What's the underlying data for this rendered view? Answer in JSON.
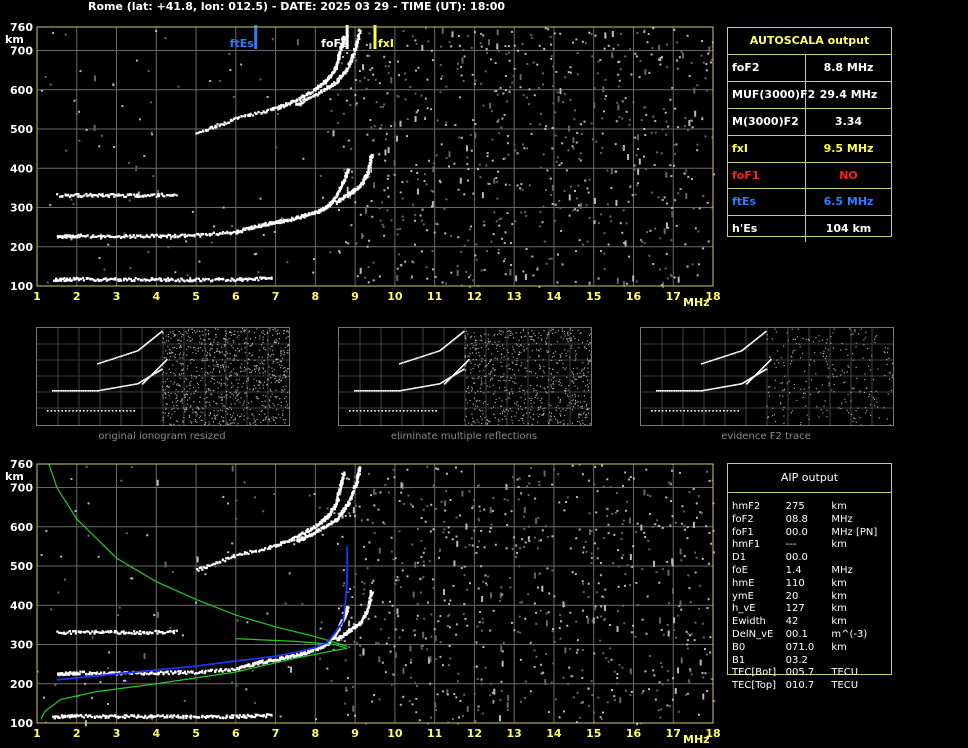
{
  "header": "Rome (lat: +41.8, lon: 012.5) - DATE: 2025 03 29 - TIME (UT): 18:00",
  "chart_data": {
    "type": "scatter",
    "xlabel": "MHz",
    "ylabel": "km",
    "xlim": [
      1,
      18
    ],
    "ylim": [
      100,
      760
    ],
    "xticks": [
      1,
      2,
      3,
      4,
      5,
      6,
      7,
      8,
      9,
      10,
      11,
      12,
      13,
      14,
      15,
      16,
      17,
      18
    ],
    "yticks": [
      100,
      200,
      300,
      400,
      500,
      600,
      700,
      760
    ],
    "grid": true,
    "markers": [
      {
        "label": "ftEs",
        "x": 6.5,
        "color": "#2f7cff"
      },
      {
        "label": "foF2",
        "x": 8.8,
        "color": "#ffffff"
      },
      {
        "label": "fxI",
        "x": 9.5,
        "color": "#ffff33"
      }
    ],
    "traces": [
      {
        "name": "Es",
        "points": [
          [
            1.4,
            118
          ],
          [
            2,
            120
          ],
          [
            3,
            119
          ],
          [
            4,
            119
          ],
          [
            5,
            118
          ],
          [
            6,
            119
          ],
          [
            6.9,
            122
          ]
        ]
      },
      {
        "name": "Es-2nd",
        "points": [
          [
            1.5,
            333
          ],
          [
            2.5,
            334
          ],
          [
            3.5,
            333
          ],
          [
            4.5,
            335
          ]
        ]
      },
      {
        "name": "F-ordinary",
        "points": [
          [
            1.5,
            228
          ],
          [
            2,
            230
          ],
          [
            3,
            229
          ],
          [
            4,
            230
          ],
          [
            5,
            232
          ],
          [
            6,
            240
          ],
          [
            6.5,
            255
          ],
          [
            7,
            265
          ],
          [
            7.5,
            275
          ],
          [
            8,
            290
          ],
          [
            8.3,
            305
          ],
          [
            8.5,
            330
          ],
          [
            8.7,
            370
          ],
          [
            8.8,
            400
          ]
        ]
      },
      {
        "name": "F-extraordinary",
        "points": [
          [
            8.5,
            315
          ],
          [
            8.8,
            335
          ],
          [
            9.1,
            355
          ],
          [
            9.3,
            390
          ],
          [
            9.4,
            440
          ]
        ]
      },
      {
        "name": "F-2hop-ordinary",
        "points": [
          [
            5,
            492
          ],
          [
            6,
            530
          ],
          [
            7,
            555
          ],
          [
            7.5,
            575
          ],
          [
            8,
            605
          ],
          [
            8.3,
            630
          ],
          [
            8.5,
            660
          ],
          [
            8.6,
            700
          ],
          [
            8.7,
            740
          ]
        ]
      },
      {
        "name": "F-2hop-extraordinary",
        "points": [
          [
            7.5,
            565
          ],
          [
            8,
            590
          ],
          [
            8.5,
            620
          ],
          [
            8.8,
            660
          ],
          [
            9,
            710
          ],
          [
            9.1,
            755
          ]
        ]
      }
    ],
    "profile_blue": [
      [
        1.5,
        210
      ],
      [
        2,
        215
      ],
      [
        3,
        225
      ],
      [
        4,
        235
      ],
      [
        5,
        245
      ],
      [
        6,
        258
      ],
      [
        7,
        270
      ],
      [
        7.5,
        280
      ],
      [
        8,
        292
      ],
      [
        8.3,
        305
      ],
      [
        8.5,
        330
      ],
      [
        8.7,
        360
      ],
      [
        8.75,
        400
      ],
      [
        8.8,
        460
      ],
      [
        8.8,
        550
      ]
    ],
    "profile_green_lower": [
      [
        1.1,
        110
      ],
      [
        1.2,
        130
      ],
      [
        1.6,
        160
      ],
      [
        2.5,
        180
      ],
      [
        4,
        200
      ],
      [
        6,
        230
      ],
      [
        7.5,
        265
      ],
      [
        8.5,
        285
      ],
      [
        8.8,
        290
      ],
      [
        8.5,
        300
      ],
      [
        7.5,
        308
      ],
      [
        6,
        315
      ]
    ],
    "profile_green_upper": [
      [
        1.3,
        760
      ],
      [
        1.5,
        700
      ],
      [
        2,
        620
      ],
      [
        3,
        520
      ],
      [
        4,
        460
      ],
      [
        5,
        415
      ],
      [
        6,
        375
      ],
      [
        7,
        345
      ],
      [
        8,
        320
      ],
      [
        8.5,
        305
      ],
      [
        8.8,
        295
      ]
    ]
  },
  "autoscala": {
    "title": "AUTOSCALA output",
    "rows": [
      {
        "key": "foF2",
        "value": "8.8 MHz",
        "color": "#ffffff"
      },
      {
        "key": "MUF(3000)F2",
        "value": "29.4 MHz",
        "color": "#ffffff"
      },
      {
        "key": "M(3000)F2",
        "value": "3.34",
        "color": "#ffffff"
      },
      {
        "key": "fxI",
        "value": "9.5 MHz",
        "color": "#ffff33"
      },
      {
        "key": "foF1",
        "value": "NO",
        "color": "#ff2222"
      },
      {
        "key": "ftEs",
        "value": "6.5 MHz",
        "color": "#2f7cff"
      },
      {
        "key": "h'Es",
        "value": "104    km",
        "color": "#ffffff"
      }
    ]
  },
  "thumbnails": [
    {
      "label": "original ionogram resized"
    },
    {
      "label": "eliminate multiple reflections"
    },
    {
      "label": "evidence F2 trace"
    }
  ],
  "aip": {
    "title": "AIP output",
    "rows": [
      {
        "key": "hmF2",
        "value": "275",
        "unit": "km"
      },
      {
        "key": "foF2",
        "value": "08.8",
        "unit": "MHz"
      },
      {
        "key": "foF1",
        "value": "00.0",
        "unit": "MHz    [PN]"
      },
      {
        "key": "hmF1",
        "value": "---",
        "unit": "km"
      },
      {
        "key": "D1",
        "value": "00.0",
        "unit": ""
      },
      {
        "key": "foE",
        "value": "1.4",
        "unit": "MHz"
      },
      {
        "key": "hmE",
        "value": "110",
        "unit": "km"
      },
      {
        "key": "ymE",
        "value": "20",
        "unit": "km"
      },
      {
        "key": "h_vE",
        "value": "127",
        "unit": "km"
      },
      {
        "key": "Ewidth",
        "value": "42",
        "unit": "km"
      },
      {
        "key": "DelN_vE",
        "value": "00.1",
        "unit": "m^(-3)"
      },
      {
        "key": "B0",
        "value": "071.0",
        "unit": "km"
      },
      {
        "key": "B1",
        "value": "03.2",
        "unit": ""
      },
      {
        "key": "TEC[Bot]",
        "value": "005.7",
        "unit": "TECU"
      },
      {
        "key": "TEC[Top]",
        "value": "010.7",
        "unit": "TECU"
      }
    ]
  }
}
